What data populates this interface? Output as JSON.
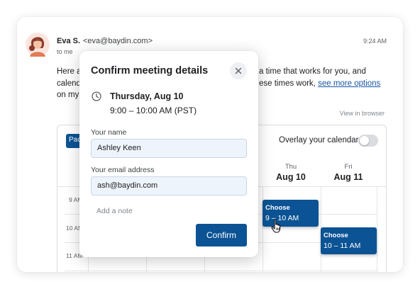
{
  "email": {
    "sender_name": "Eva S.",
    "sender_email": "<eva@baydin.com>",
    "recipient": "to me",
    "time": "9:24 AM",
    "body_line1_start": "Here a",
    "body_line1_end": "a time that works for you, and",
    "body_line2_start": "calend",
    "body_line2_end": "ese times work,",
    "see_more_link": "see more options",
    "body_line3_start": "on my",
    "view_in_browser": "View in browser"
  },
  "calendar": {
    "chip_label": "Pac",
    "overlay_label": "Overlay your calendar",
    "overlay_enabled": false,
    "days": [
      {
        "dow": "Thu",
        "date": "Aug 10"
      },
      {
        "dow": "Fri",
        "date": "Aug 11"
      }
    ],
    "time_labels": [
      "9 AM",
      "10 AM",
      "11 AM"
    ],
    "slots": [
      {
        "title": "Choose",
        "time": "9 – 10 AM"
      },
      {
        "title": "Choose",
        "time": "10 – 11 AM"
      }
    ],
    "colors": {
      "accent": "#0b5394"
    }
  },
  "modal": {
    "title": "Confirm meeting details",
    "date": "Thursday, Aug 10",
    "time_range": "9:00 – 10:00 AM (PST)",
    "name_label": "Your name",
    "name_value": "Ashley Keen",
    "email_label": "Your email address",
    "email_value": "ash@baydin.com",
    "note_placeholder": "Add a note",
    "confirm_label": "Confirm"
  },
  "icons": [
    "avatar",
    "close-icon",
    "clock-icon",
    "pointer-cursor-icon"
  ]
}
